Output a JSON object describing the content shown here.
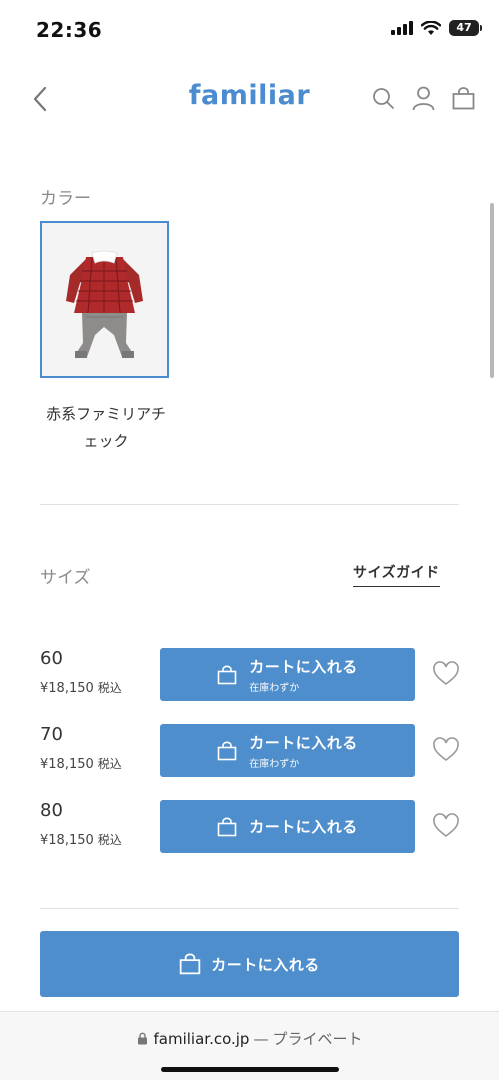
{
  "status": {
    "time": "22:36",
    "battery": "47"
  },
  "header": {
    "logo": "familiar"
  },
  "color_section": {
    "label": "カラー",
    "swatches": [
      {
        "name": "赤系ファミリアチェック",
        "name_line1": "赤系ファミリアチ",
        "name_line2": "ェック",
        "selected": true
      }
    ]
  },
  "size_section": {
    "label": "サイズ",
    "guide_link": "サイズガイド",
    "rows": [
      {
        "size": "60",
        "price": "¥18,150",
        "tax": "税込",
        "button": "カートに入れる",
        "stock": "在庫わずか"
      },
      {
        "size": "70",
        "price": "¥18,150",
        "tax": "税込",
        "button": "カートに入れる",
        "stock": "在庫わずか"
      },
      {
        "size": "80",
        "price": "¥18,150",
        "tax": "税込",
        "button": "カートに入れる",
        "stock": ""
      }
    ]
  },
  "main_cart": {
    "label": "カートに入れる"
  },
  "browser": {
    "domain": "familiar.co.jp",
    "separator": "—",
    "mode": "プライベート"
  },
  "colors": {
    "accent": "#4f8ecc",
    "logo": "#4b8bcf",
    "selected_border": "#4b8bcf"
  }
}
